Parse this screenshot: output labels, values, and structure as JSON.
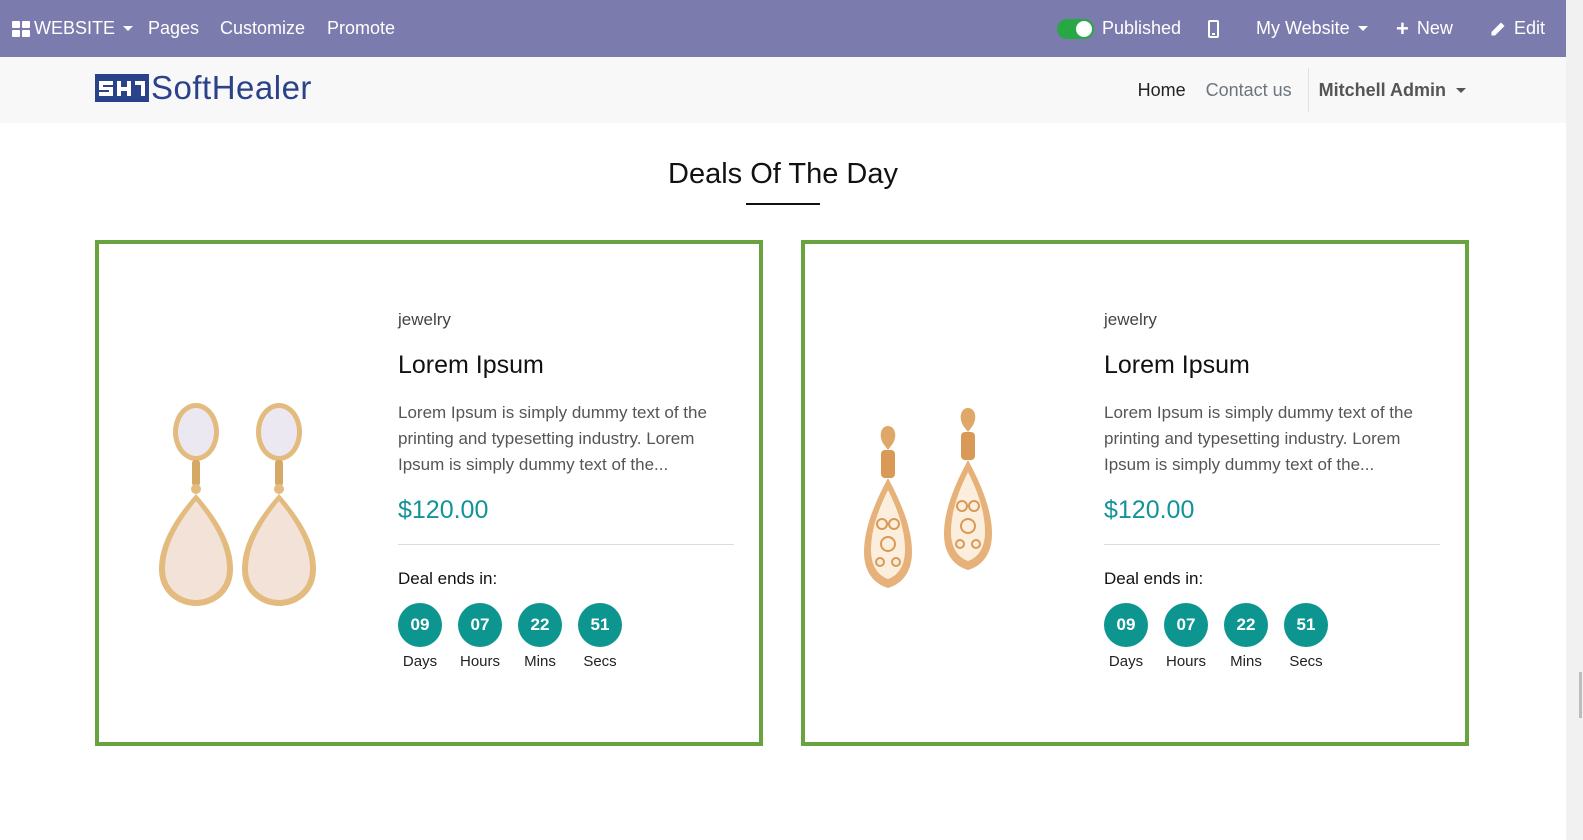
{
  "adminbar": {
    "website_label": "WEBSITE",
    "pages": "Pages",
    "customize": "Customize",
    "promote": "Promote",
    "published": "Published",
    "my_website": "My Website",
    "new": "New",
    "edit": "Edit"
  },
  "header": {
    "logo_text": "SoftHealer",
    "nav": {
      "home": "Home",
      "contact": "Contact us",
      "user": "Mitchell Admin"
    }
  },
  "section": {
    "title": "Deals Of The Day"
  },
  "deals": [
    {
      "category": "jewelry",
      "title": "Lorem Ipsum",
      "description": "Lorem Ipsum is simply dummy text of the printing and typesetting industry. Lorem Ipsum is simply dummy text of the...",
      "price": "$120.00",
      "deal_label": "Deal ends in:",
      "countdown": [
        {
          "value": "09",
          "unit": "Days"
        },
        {
          "value": "07",
          "unit": "Hours"
        },
        {
          "value": "22",
          "unit": "Mins"
        },
        {
          "value": "51",
          "unit": "Secs"
        }
      ],
      "image_icon": "pearl-drop-earrings"
    },
    {
      "category": "jewelry",
      "title": "Lorem Ipsum",
      "description": "Lorem Ipsum is simply dummy text of the printing and typesetting industry. Lorem Ipsum is simply dummy text of the...",
      "price": "$120.00",
      "deal_label": "Deal ends in:",
      "countdown": [
        {
          "value": "09",
          "unit": "Days"
        },
        {
          "value": "07",
          "unit": "Hours"
        },
        {
          "value": "22",
          "unit": "Mins"
        },
        {
          "value": "51",
          "unit": "Secs"
        }
      ],
      "image_icon": "filigree-gold-earrings"
    }
  ],
  "colors": {
    "adminbar_bg": "#7c7bad",
    "card_border": "#68a33f",
    "accent_teal": "#0d9690",
    "price_color": "#12939a",
    "toggle_on": "#28a745"
  }
}
